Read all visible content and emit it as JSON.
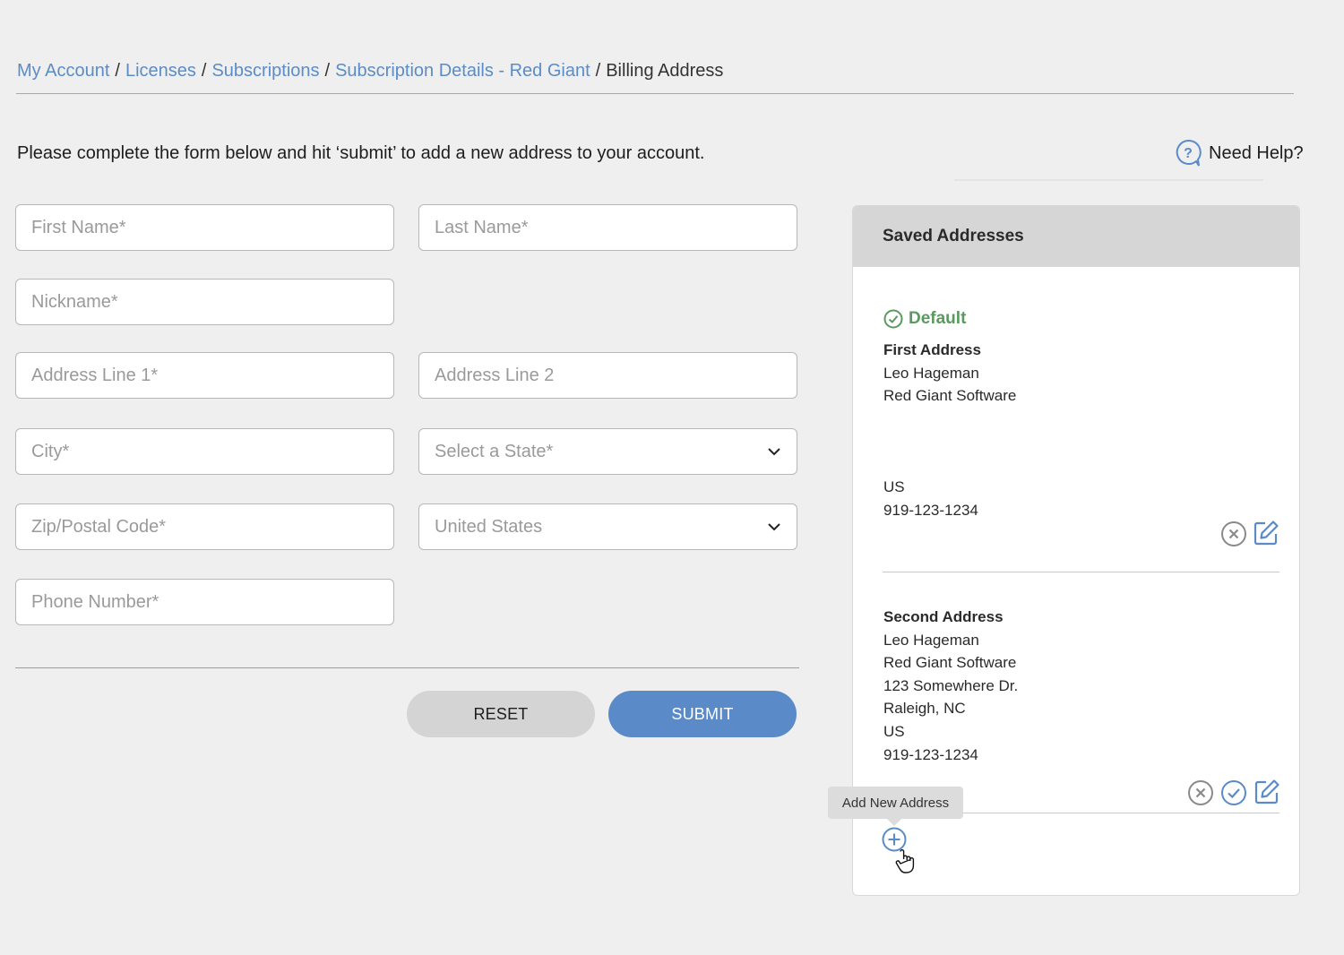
{
  "breadcrumb": {
    "items": [
      "My Account",
      "Licenses",
      "Subscriptions",
      "Subscription Details - Red Giant"
    ],
    "current": "Billing Address",
    "separator": "/"
  },
  "intro": "Please complete the form below and hit ‘submit’ to add a new address to your account.",
  "help": {
    "label": "Need Help?",
    "icon": "question-bubble-icon"
  },
  "form": {
    "first_name": "First Name*",
    "last_name": "Last Name*",
    "nickname": "Nickname*",
    "address1": "Address Line 1*",
    "address2": "Address Line 2",
    "city": "City*",
    "state": "Select a State*",
    "zip": "Zip/Postal Code*",
    "country": "United States",
    "phone": "Phone Number*",
    "reset": "RESET",
    "submit": "SUBMIT"
  },
  "saved": {
    "title": "Saved Addresses",
    "default_label": "Default",
    "first": {
      "nickname": "First Address",
      "name": "Leo Hageman",
      "company": "Red Giant Software",
      "country": "US",
      "phone": "919-123-1234"
    },
    "second": {
      "nickname": "Second Address",
      "name": "Leo Hageman",
      "company": "Red Giant Software",
      "street": "123 Somewhere Dr.",
      "city_state": "Raleigh, NC",
      "country": "US",
      "phone": "919-123-1234"
    },
    "add_tooltip": "Add New Address"
  },
  "colors": {
    "link": "#5b8cc7",
    "primary": "#5a8bc8",
    "success": "#5a9a5f",
    "muted_icon": "#8a8a8a"
  }
}
